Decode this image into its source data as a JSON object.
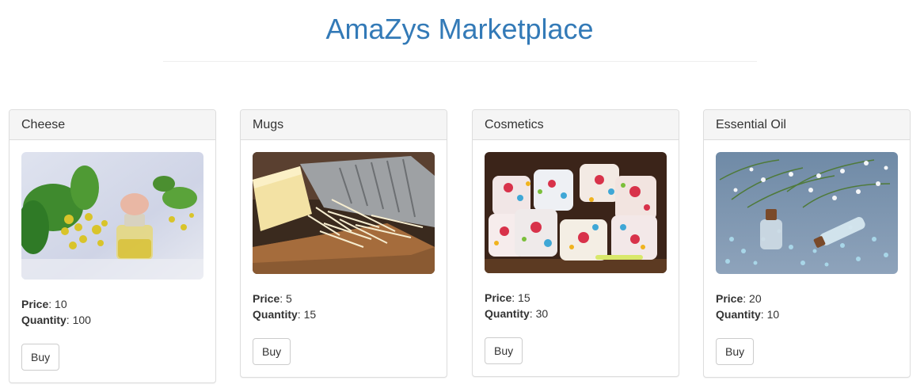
{
  "page": {
    "title": "AmaZys Marketplace"
  },
  "labels": {
    "price": "Price",
    "quantity": "Quantity",
    "buy": "Buy"
  },
  "products": [
    {
      "name": "Cheese",
      "price": "10",
      "quantity": "100",
      "image_icon": "essential-oil-flowers-image"
    },
    {
      "name": "Mugs",
      "price": "5",
      "quantity": "15",
      "image_icon": "cheese-grater-image"
    },
    {
      "name": "Cosmetics",
      "price": "15",
      "quantity": "30",
      "image_icon": "floral-mugs-image"
    },
    {
      "name": "Essential Oil",
      "price": "20",
      "quantity": "10",
      "image_icon": "bath-salt-bottles-image"
    }
  ],
  "colors": {
    "title": "#337ab7",
    "card_header_bg": "#f5f5f5",
    "border": "#dddddd"
  }
}
